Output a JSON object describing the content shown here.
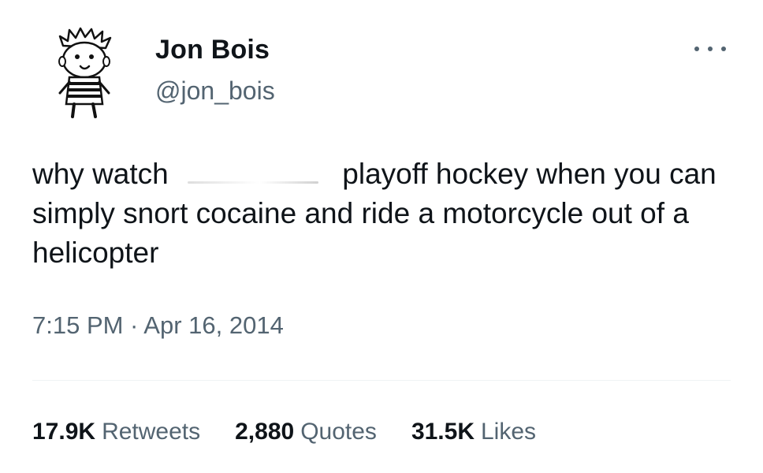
{
  "author": {
    "display_name": "Jon Bois",
    "handle": "@jon_bois",
    "avatar_icon": "calvin-cartoon-avatar"
  },
  "menu": {
    "more_icon": "more-horizontal-icon"
  },
  "tweet": {
    "text_before": "why watch ",
    "text_after": " playoff hockey when you can simply snort cocaine and ride a motorcycle out of a helicopter",
    "timestamp": "7:15 PM · Apr 16, 2014"
  },
  "stats": {
    "retweets_count": "17.9K",
    "retweets_label": "Retweets",
    "quotes_count": "2,880",
    "quotes_label": "Quotes",
    "likes_count": "31.5K",
    "likes_label": "Likes"
  },
  "colors": {
    "text_primary": "#0f1419",
    "text_secondary": "#536471",
    "divider": "#eff3f4"
  }
}
